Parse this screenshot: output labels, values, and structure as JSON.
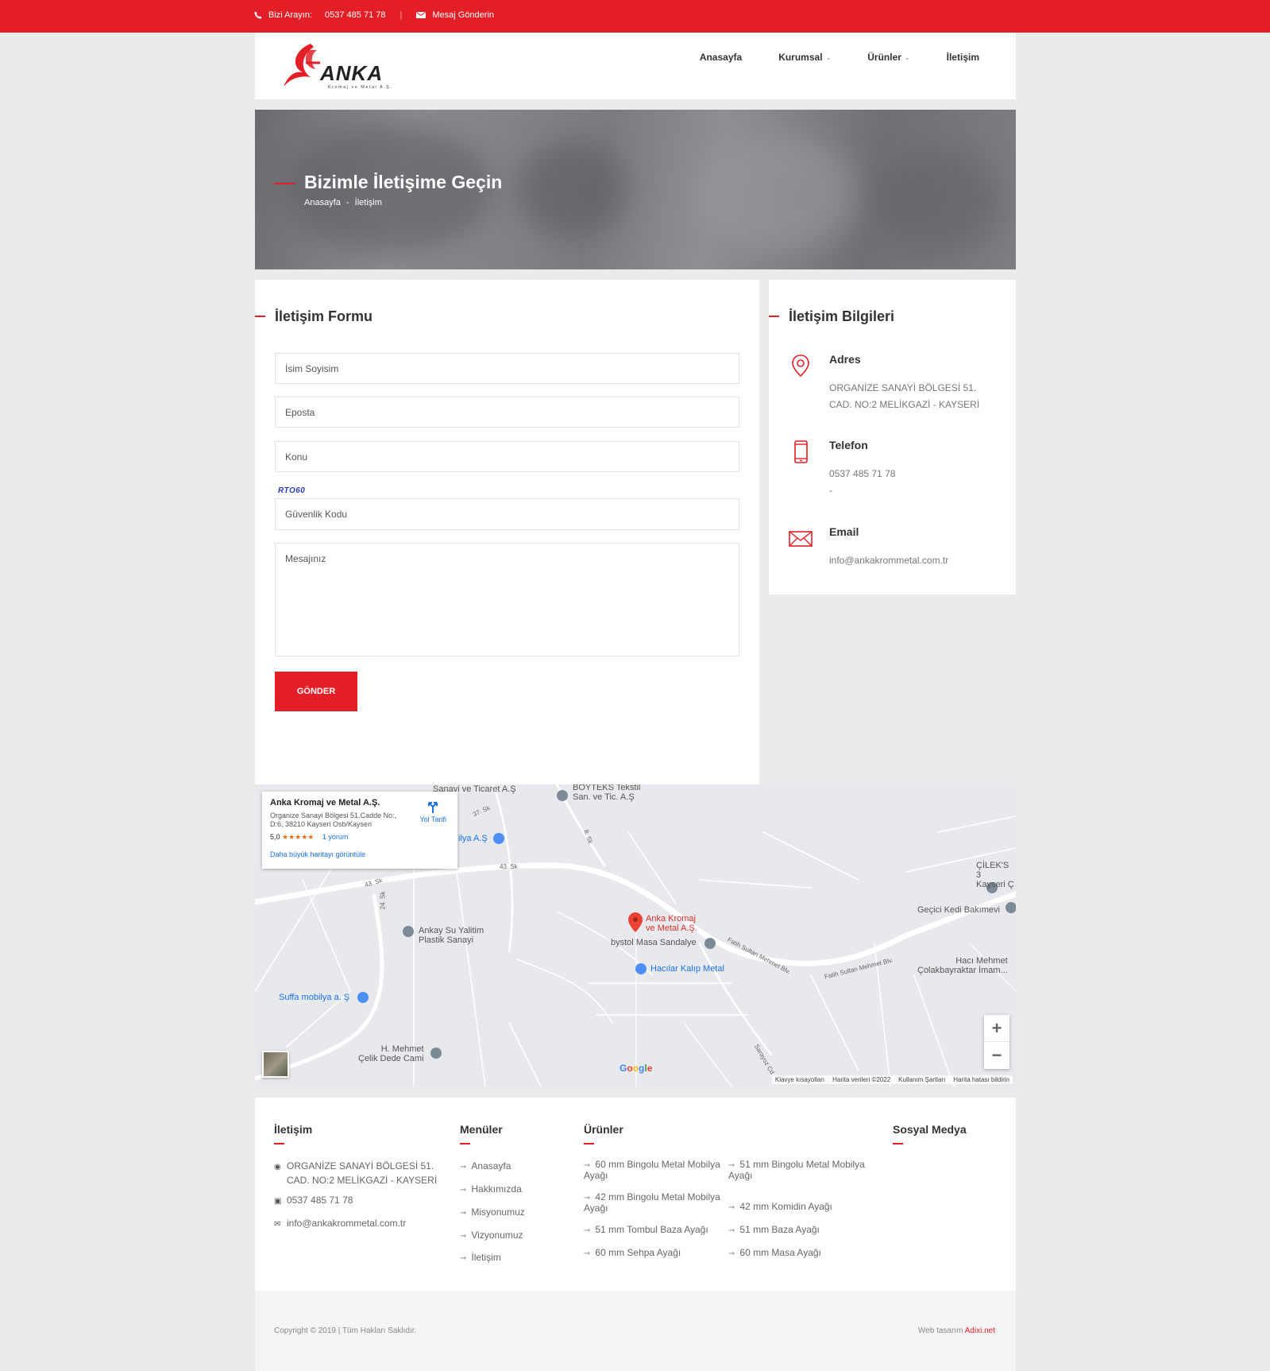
{
  "topbar": {
    "call_label": "Bizi Arayın:",
    "phone": "0537 485 71 78",
    "message_label": "Mesaj Gönderin"
  },
  "header": {
    "logo_text": "ANKA",
    "logo_sub": "Kromaj ve Metal A.Ş.",
    "nav": [
      {
        "label": "Anasayfa",
        "dropdown": false
      },
      {
        "label": "Kurumsal",
        "dropdown": true
      },
      {
        "label": "Ürünler",
        "dropdown": true
      },
      {
        "label": "İletişim",
        "dropdown": false
      }
    ]
  },
  "banner": {
    "title": "Bizimle İletişime Geçin",
    "crumb_home": "Anasayfa",
    "crumb_sep": "-",
    "crumb_current": "İletişim"
  },
  "form": {
    "title": "İletişim Formu",
    "name_placeholder": "İsim Soyisim",
    "email_placeholder": "Eposta",
    "subject_placeholder": "Konu",
    "captcha_code": "RTO60",
    "captcha_placeholder": "Güvenlik Kodu",
    "message_placeholder": "Mesajınız",
    "submit_label": "GÖNDER"
  },
  "info": {
    "title": "İletişim Bilgileri",
    "address_label": "Adres",
    "address_line1": "ORGANİZE SANAYİ BÖLGESİ 51.",
    "address_line2": "CAD. NO:2 MELİKGAZİ - KAYSERİ",
    "phone_label": "Telefon",
    "phone": "0537 485 71 78",
    "phone_extra": "-",
    "email_label": "Email",
    "email": "info@ankakrommetal.com.tr"
  },
  "map": {
    "card_name": "Anka Kromaj ve Metal A.Ş.",
    "card_address": "Organize Sanayi Bölgesi 51.Cadde No:, D:6, 38210 Kayseri Osb/Kayseri",
    "rating": "5,0",
    "stars": "★★★★★",
    "reviews": "1 yorum",
    "bigger_map": "Daha büyük haritayı görüntüle",
    "directions": "Yol Tarifi",
    "labels": {
      "anka": "Anka Kromaj\nve Metal A.Ş.",
      "ankay": "Ankay Su Yalitim\nPlastik Sanayi",
      "bystol": "bystol Masa Sandalye",
      "hacilar": "Hacılar Kalıp Metal",
      "suffa": "Suffa mobilya a. Ş",
      "cami": "H. Mehmet\nÇelik Dede Cami",
      "kedi": "Geçici Kedi Bakımevi",
      "cilek": "ÇİLEK'S 3\nKayseri Ç",
      "haci": "Hacı Mehmet\nÇolakbayraktar İmam...",
      "boyteks": "BOYTEKS Tekstil\nSan. ve Tic. A.Ş",
      "sanayi": "Sanayi ve Ticaret A.Ş",
      "ilya": "ilya A.Ş",
      "fatih1": "Fatih Sultan Mehmet Blv.",
      "fatih2": "Fatih Sultan Mehmet Blv.",
      "sk43a": "43. Sk",
      "sk43b": "43. Sk",
      "sk24": "24. Sk",
      "sk37": "37. Sk",
      "sk8": "8. Sk",
      "sarayoz": "Sarayoz Cd"
    },
    "google": "Google",
    "footer_items": [
      "Klavye kısayolları",
      "Harita verileri ©2022",
      "Kullanım Şartları",
      "Harita hatası bildirin"
    ]
  },
  "footer": {
    "contact_title": "İletişim",
    "contact_address1": "ORGANİZE SANAYİ BÖLGESİ 51.",
    "contact_address2": "CAD. NO:2 MELİKGAZİ - KAYSERİ",
    "contact_phone": "0537 485 71 78",
    "contact_email": "info@ankakrommetal.com.tr",
    "menus_title": "Menüler",
    "menus": [
      "Anasayfa",
      "Hakkımızda",
      "Misyonumuz",
      "Vizyonumuz",
      "İletişim"
    ],
    "products_title": "Ürünler",
    "products": [
      "60 mm Bingolu Metal Mobilya\nAyağı",
      "51 mm Bingolu Metal Mobilya\nAyağı",
      "42 mm Bingolu Metal Mobilya\nAyağı",
      "42 mm Komidin Ayağı",
      "51 mm Tombul Baza Ayağı",
      "51 mm Baza Ayağı",
      "60 mm Sehpa Ayağı",
      "60 mm Masa Ayağı"
    ],
    "social_title": "Sosyal Medya"
  },
  "bottom": {
    "copyright": "Copyright © 2019 | Tüm Hakları Saklıdır.",
    "web_label": "Web tasarım",
    "web_brand": "Adixi.net"
  },
  "colors": {
    "brand_red": "#e31e26",
    "page_bg": "#ebebeb",
    "map_bg": "#e8e9ec",
    "link_blue": "#1a73e8"
  }
}
